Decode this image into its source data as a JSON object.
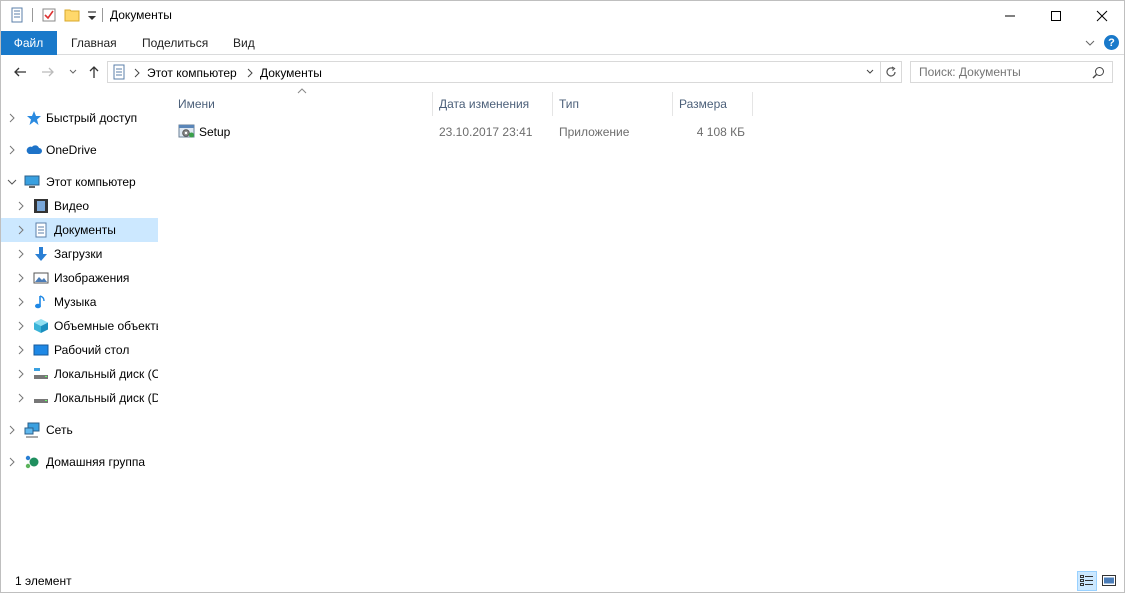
{
  "window": {
    "title": "Документы"
  },
  "ribbon": {
    "tabs": {
      "file": "Файл",
      "home": "Главная",
      "share": "Поделиться",
      "view": "Вид"
    },
    "help_glyph": "?"
  },
  "address": {
    "crumbs": [
      "Этот компьютер",
      "Документы"
    ],
    "search_placeholder": "Поиск: Документы"
  },
  "nav": {
    "items": [
      {
        "label": "Быстрый доступ",
        "icon": "star-icon"
      },
      {
        "label": "OneDrive",
        "icon": "cloud-icon"
      },
      {
        "label": "Этот компьютер",
        "icon": "computer-icon"
      },
      {
        "label": "Видео",
        "icon": "video-icon"
      },
      {
        "label": "Документы",
        "icon": "documents-icon"
      },
      {
        "label": "Загрузки",
        "icon": "downloads-icon"
      },
      {
        "label": "Изображения",
        "icon": "pictures-icon"
      },
      {
        "label": "Музыка",
        "icon": "music-icon"
      },
      {
        "label": "Объемные объекты",
        "icon": "3d-objects-icon"
      },
      {
        "label": "Рабочий стол",
        "icon": "desktop-icon"
      },
      {
        "label": "Локальный диск (C",
        "icon": "drive-c-icon"
      },
      {
        "label": "Локальный диск (D",
        "icon": "drive-d-icon"
      },
      {
        "label": "Сеть",
        "icon": "network-icon"
      },
      {
        "label": "Домашняя группа",
        "icon": "homegroup-icon"
      }
    ]
  },
  "columns": {
    "name": "Имени",
    "date": "Дата изменения",
    "type": "Тип",
    "size": "Размера"
  },
  "files": [
    {
      "name": "Setup",
      "date": "23.10.2017 23:41",
      "type": "Приложение",
      "size": "4 108 КБ",
      "icon": "setup-app-icon"
    }
  ],
  "status": {
    "item_count": "1 элемент"
  },
  "colors": {
    "accent": "#1979ca",
    "selection": "#cce8ff",
    "header_text": "#4c607a"
  }
}
